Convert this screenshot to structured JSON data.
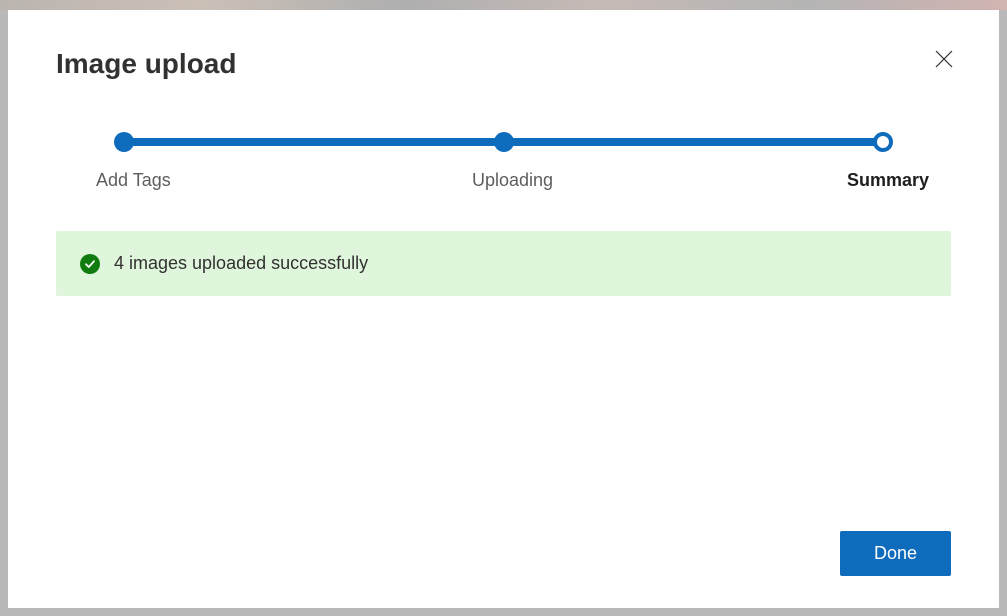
{
  "dialog": {
    "title": "Image upload",
    "steps": [
      {
        "label": "Add Tags",
        "state": "complete"
      },
      {
        "label": "Uploading",
        "state": "complete"
      },
      {
        "label": "Summary",
        "state": "current"
      }
    ],
    "status": {
      "kind": "success",
      "message": "4 images uploaded successfully"
    },
    "buttons": {
      "done": "Done"
    }
  }
}
